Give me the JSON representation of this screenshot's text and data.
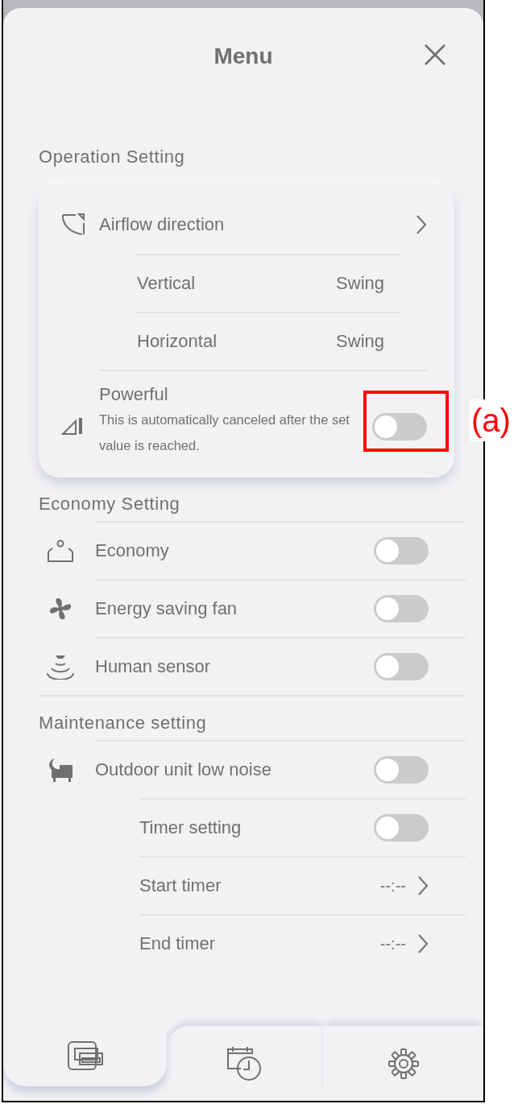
{
  "header": {
    "title": "Menu"
  },
  "sections": [
    {
      "title": "Operation Setting",
      "kind": "card",
      "items": [
        {
          "kind": "link",
          "label": "Airflow direction",
          "children": [
            {
              "kind": "value",
              "label": "Vertical",
              "value": "Swing"
            },
            {
              "kind": "value",
              "label": "Horizontal",
              "value": "Swing"
            }
          ]
        },
        {
          "kind": "toggle",
          "label": "Powerful",
          "description": "This is automatically canceled after the set value is reached.",
          "on": false
        }
      ]
    },
    {
      "title": "Economy Setting",
      "kind": "list",
      "items": [
        {
          "kind": "toggle",
          "label": "Economy",
          "on": false
        },
        {
          "kind": "toggle",
          "label": "Energy saving fan",
          "on": false
        },
        {
          "kind": "toggle",
          "label": "Human sensor",
          "on": false
        }
      ]
    },
    {
      "title": "Maintenance setting",
      "kind": "list",
      "items": [
        {
          "kind": "toggle",
          "label": "Outdoor unit low noise",
          "on": false,
          "children": [
            {
              "kind": "toggle",
              "label": "Timer setting",
              "on": false
            },
            {
              "kind": "timer",
              "label": "Start timer",
              "value": "--:--"
            },
            {
              "kind": "timer",
              "label": "End timer",
              "value": "--:--"
            }
          ]
        }
      ]
    }
  ],
  "bottom_nav": [
    {
      "selected": true
    },
    {
      "selected": false
    },
    {
      "selected": false
    }
  ],
  "callout": {
    "label": "(a)"
  }
}
